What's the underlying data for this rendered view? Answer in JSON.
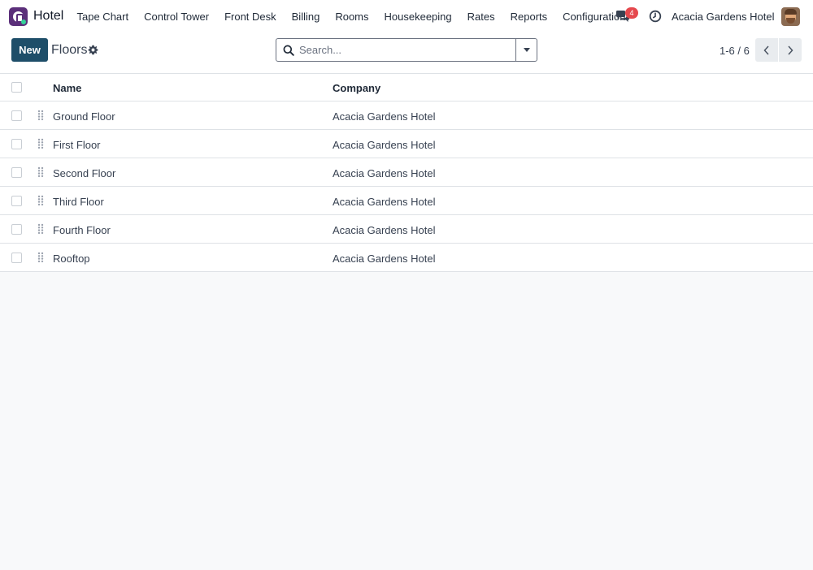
{
  "app": {
    "name": "Hotel"
  },
  "menu": [
    "Tape Chart",
    "Control Tower",
    "Front Desk",
    "Billing",
    "Rooms",
    "Housekeeping",
    "Rates",
    "Reports",
    "Configuration"
  ],
  "systray": {
    "messages_count": "4",
    "company": "Acacia Gardens Hotel"
  },
  "control_panel": {
    "new_label": "New",
    "title": "Floors",
    "search_placeholder": "Search...",
    "pager": "1-6 / 6"
  },
  "list": {
    "columns": {
      "name": "Name",
      "company": "Company"
    },
    "rows": [
      {
        "name": "Ground Floor",
        "company": "Acacia Gardens Hotel"
      },
      {
        "name": "First Floor",
        "company": "Acacia Gardens Hotel"
      },
      {
        "name": "Second Floor",
        "company": "Acacia Gardens Hotel"
      },
      {
        "name": "Third Floor",
        "company": "Acacia Gardens Hotel"
      },
      {
        "name": "Fourth Floor",
        "company": "Acacia Gardens Hotel"
      },
      {
        "name": "Rooftop",
        "company": "Acacia Gardens Hotel"
      }
    ]
  },
  "icons": {
    "app": "hotel-app-icon",
    "chat": "chat-icon",
    "activity": "clock-icon",
    "settings": "gear-icon",
    "search": "search-icon",
    "drag": "drag-handle-icon"
  },
  "colors": {
    "primary": "#1e4e69",
    "badge": "#e5484d",
    "app_icon": "#5b2f7a"
  }
}
